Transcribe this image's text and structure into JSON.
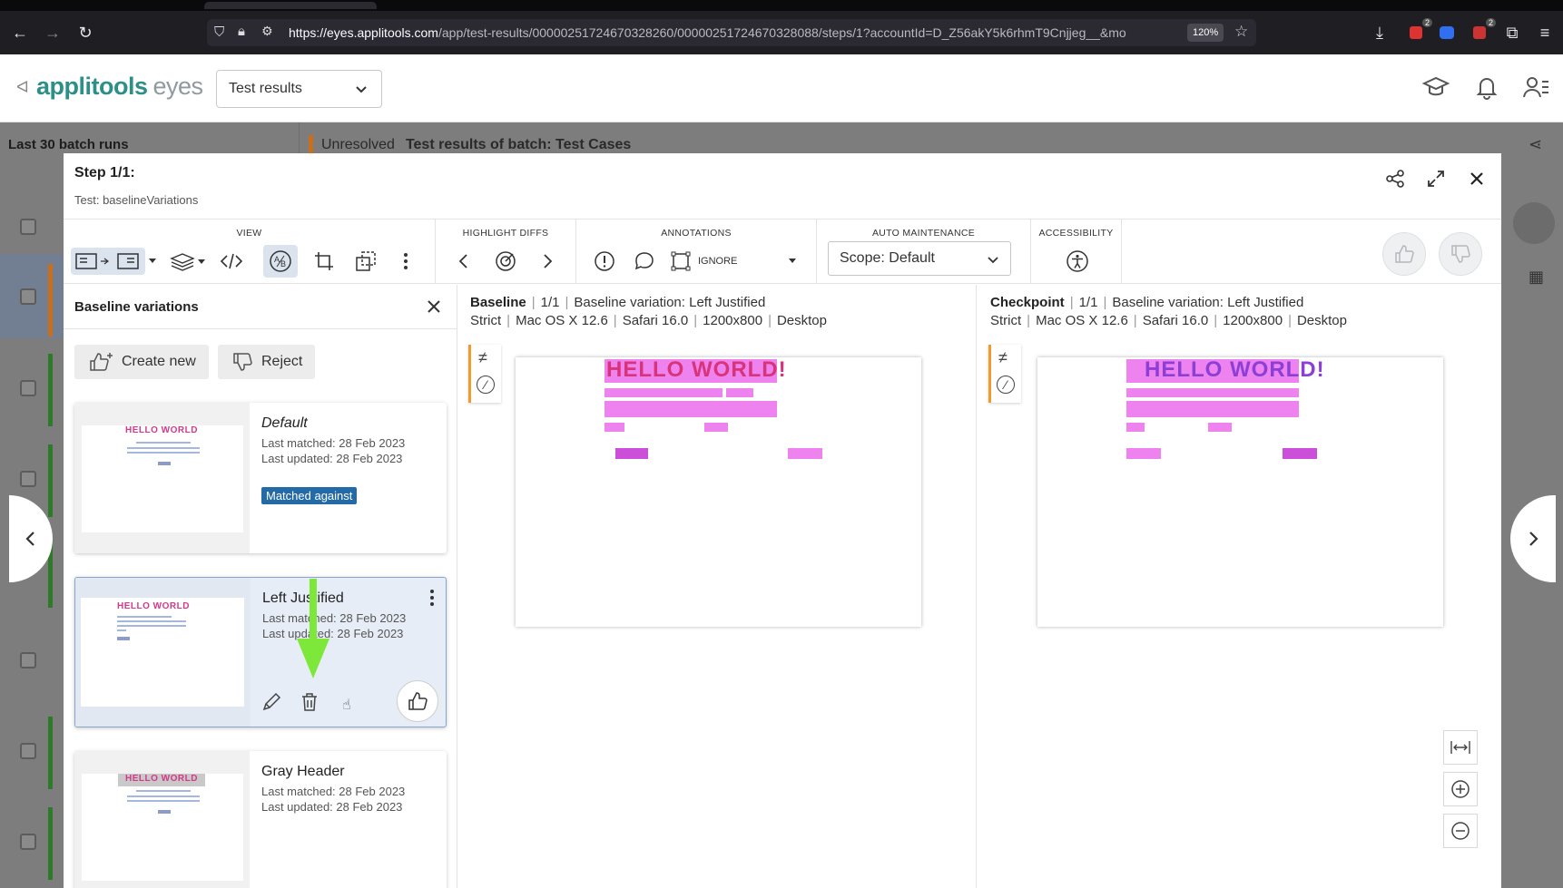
{
  "browser": {
    "url_host": "https://eyes.applitools.com",
    "url_path": "/app/test-results/00000251724670328260/00000251724670328088/steps/1?accountId=D_Z56akY5k6rhmT9Cnjjeg__&mo",
    "zoom": "120%",
    "badge1": "2",
    "badge2": "2"
  },
  "app": {
    "logo_primary": "applitools",
    "logo_secondary": "eyes",
    "view_select": "Test results"
  },
  "backdrop": {
    "sidebar_title": "Last 30 batch runs",
    "status": "Unresolved",
    "batch_title": "Test results of batch:  Test Cases"
  },
  "modal": {
    "step_title": "Step 1/1:",
    "test_name": "Test: baselineVariations"
  },
  "toolbar": {
    "view_label": "VIEW",
    "highlight_label": "HIGHLIGHT DIFFS",
    "annotations_label": "ANNOTATIONS",
    "ignore_label": "IGNORE",
    "auto_label": "AUTO MAINTENANCE",
    "scope_value": "Scope: Default",
    "accessibility_label": "ACCESSIBILITY"
  },
  "variations_panel": {
    "title": "Baseline variations",
    "create_label": "Create new",
    "reject_label": "Reject",
    "items": [
      {
        "name": "Default",
        "last_matched": "Last matched: 28 Feb 2023",
        "last_updated": "Last updated: 28 Feb 2023",
        "badge": "Matched against"
      },
      {
        "name": "Left Justified",
        "last_matched": "Last matched: 28 Feb 2023",
        "last_updated": "Last updated: 28 Feb 2023"
      },
      {
        "name": "Gray Header",
        "last_matched": "Last matched: 28 Feb 2023",
        "last_updated": "Last updated: 28 Feb 2023"
      }
    ],
    "thumb_hello": "HELLO WORLD"
  },
  "baseline": {
    "kind": "Baseline",
    "index": "1/1",
    "variation": "Baseline variation: Left Justified",
    "match_level": "Strict",
    "os": "Mac OS X 12.6",
    "browser": "Safari 16.0",
    "viewport": "1200x800",
    "device": "Desktop",
    "hello": "HELLO WORLD!"
  },
  "checkpoint": {
    "kind": "Checkpoint",
    "index": "1/1",
    "variation": "Baseline variation: Left Justified",
    "match_level": "Strict",
    "os": "Mac OS X 12.6",
    "browser": "Safari 16.0",
    "viewport": "1200x800",
    "device": "Desktop",
    "hello": "HELLO WORLD!"
  },
  "colors": {
    "brand_teal": "#2d8f87",
    "diff_magenta": "#ee82ee",
    "accent_orange": "#ef9b2d",
    "badge_blue": "#236aa7",
    "arrow_green": "#7ee83a"
  }
}
